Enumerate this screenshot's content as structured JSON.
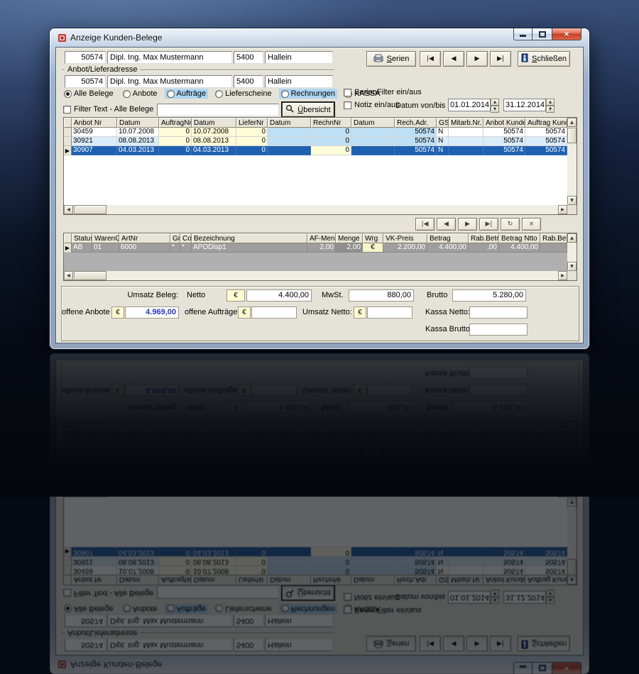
{
  "window": {
    "title": "Anzeige Kunden-Belege"
  },
  "address": {
    "number": "50574",
    "name": "Dipl. Ing. Max Mustermann",
    "zip": "5400",
    "city": "Hallein",
    "group_label": "Anbot/Lieferadresse",
    "delivery_number": "50574",
    "delivery_name": "Dipl. Ing. Max Mustermann",
    "delivery_zip": "5400",
    "delivery_city": "Hallein"
  },
  "toolbar": {
    "serien_label": "Serien",
    "schliessen_label": "Schließen",
    "nav_buttons": [
      {
        "name": "first-record",
        "glyph": "|◀"
      },
      {
        "name": "prior-record",
        "glyph": "◀"
      },
      {
        "name": "next-record",
        "glyph": "▶"
      },
      {
        "name": "last-record",
        "glyph": "▶|"
      }
    ]
  },
  "filters": {
    "doc_types": [
      {
        "label": "Alle Belege",
        "checked": true,
        "highlight": null
      },
      {
        "label": "Anbote",
        "checked": false,
        "highlight": null
      },
      {
        "label": "Aufträge",
        "checked": false,
        "highlight": "#aed6f2"
      },
      {
        "label": "Lieferscheine",
        "checked": false,
        "highlight": null
      },
      {
        "label": "Rechnungen",
        "checked": false,
        "highlight": "#aed6f2"
      },
      {
        "label": "KASSA",
        "checked": false,
        "highlight": null
      }
    ],
    "serienfilter_label": "SerienFilter ein/aus",
    "notiz_label": "Notiz ein/aus",
    "datum_label": "Datum von/bis",
    "date_from": "01.01.2014",
    "date_to": "31.12.2014",
    "filter_text_label": "Filter Text - Alle Belege",
    "filter_text_value": "",
    "uebersicht_label": "Übersicht"
  },
  "main_grid": {
    "columns": [
      "Anbot Nr",
      "Datum",
      "AuftragNr",
      "Datum",
      "LieferNr",
      "Datum",
      "RechnNr",
      "Datum",
      "Rech.Adr.",
      "GS",
      "Mitarb.Nr.",
      "Anbot Kunde",
      "Auftrag Kunde"
    ],
    "rows": [
      {
        "selected": false,
        "tint": false,
        "cells": [
          "30459",
          "10.07.2008",
          "0",
          "10.07.2008",
          "0",
          "",
          "0",
          "",
          "50574",
          "N",
          "",
          "50574",
          "50574"
        ]
      },
      {
        "selected": false,
        "tint": true,
        "cells": [
          "30921",
          "08.08.2013",
          "0",
          "08.08.2013",
          "0",
          "",
          "0",
          "",
          "50574",
          "N",
          "",
          "50574",
          "50574"
        ]
      },
      {
        "selected": true,
        "tint": false,
        "cells": [
          "30907",
          "04.03.2013",
          "0",
          "04.03.2013",
          "0",
          "",
          "0",
          "",
          "50574",
          "N",
          "",
          "50574",
          "50574"
        ]
      }
    ]
  },
  "record_navigator": [
    {
      "name": "first",
      "glyph": "|◀"
    },
    {
      "name": "prior",
      "glyph": "◀"
    },
    {
      "name": "next",
      "glyph": "▶"
    },
    {
      "name": "last",
      "glyph": "▶|"
    },
    {
      "name": "refresh",
      "glyph": "↻"
    },
    {
      "name": "delete",
      "glyph": "×"
    }
  ],
  "detail_grid": {
    "columns": [
      "Status",
      "WarenGrp",
      "ArtNr",
      "Gr",
      "Co",
      "Bezeichnung",
      "AF-Menge",
      "Menge",
      "Wrg",
      "VK-Preis",
      "Betrag",
      "Rab.Betr.",
      "Betrag Ntto",
      "Rab.Bet"
    ],
    "rows": [
      {
        "selected": true,
        "cells": [
          "AB",
          "01",
          "6000",
          "*",
          "*",
          "APODisp1",
          "2,00",
          "2,00",
          "€",
          "2.200,00",
          "4.400,00",
          ",00",
          "4.400,00",
          ""
        ]
      }
    ]
  },
  "summary": {
    "currency": "€",
    "umsatz_beleg_label": "Umsatz Beleg:",
    "netto_label": "Netto",
    "netto_value": "4.400,00",
    "mwst_label": "MwSt.",
    "mwst_value": "880,00",
    "brutto_label": "Brutto",
    "brutto_value": "5.280,00",
    "offene_anbote_label": "offene Anbote",
    "offene_anbote_value": "4.969,00",
    "offene_auftraege_label": "offene Aufträge",
    "offene_auftraege_value": "",
    "umsatz_netto_label": "Umsatz Netto:",
    "umsatz_netto_value": "",
    "kassa_netto_label": "Kassa Netto:",
    "kassa_netto_value": "",
    "kassa_brutto_label": "Kassa Brutto:",
    "kassa_brutto_value": ""
  },
  "colors": {
    "selection": "#1f61b0",
    "col_auftrag": "#fffcd9",
    "col_rechnung": "#bedff4",
    "highlight_radio": "#aed6f2",
    "offene_anbote_text": "#2836b8",
    "close_button": "#c33f24"
  }
}
